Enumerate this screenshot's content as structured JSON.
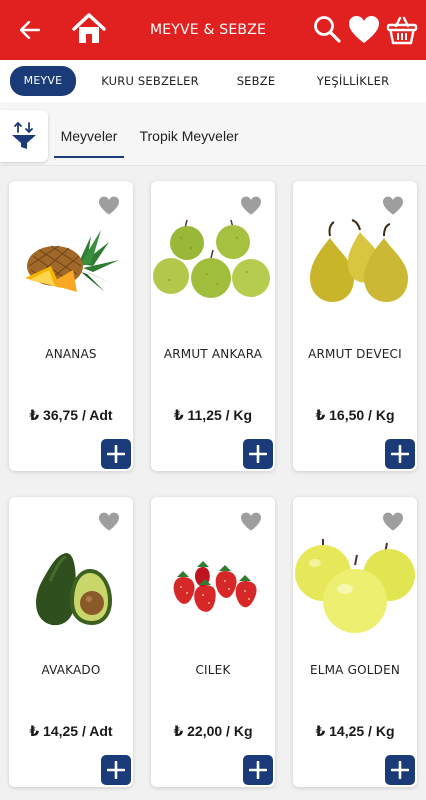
{
  "header": {
    "title": "MEYVE & SEBZE",
    "color": "#e0211f"
  },
  "categories": [
    {
      "label": "MEYVE",
      "active": true
    },
    {
      "label": "KURU SEBZELER",
      "active": false
    },
    {
      "label": "SEBZE",
      "active": false
    },
    {
      "label": "YEŞİLLİKLER",
      "active": false
    }
  ],
  "subtabs": [
    {
      "label": "Meyveler",
      "active": true
    },
    {
      "label": "Tropik Meyveler",
      "active": false
    }
  ],
  "products": [
    {
      "name": "ANANAS",
      "price": "₺ 36,75 / Adt",
      "image": "pineapple"
    },
    {
      "name": "ARMUT ANKARA",
      "price": "₺ 11,25 / Kg",
      "image": "green-pears"
    },
    {
      "name": "ARMUT DEVECI",
      "price": "₺ 16,50 / Kg",
      "image": "yellow-pears"
    },
    {
      "name": "AVAKADO",
      "price": "₺ 14,25 / Adt",
      "image": "avocado"
    },
    {
      "name": "CILEK",
      "price": "₺ 22,00 / Kg",
      "image": "strawberries"
    },
    {
      "name": "ELMA GOLDEN",
      "price": "₺ 14,25 / Kg",
      "image": "golden-apples"
    }
  ],
  "colors": {
    "brand_red": "#e0211f",
    "navy": "#1b3a78",
    "fav_gray": "#9e9e9e"
  }
}
